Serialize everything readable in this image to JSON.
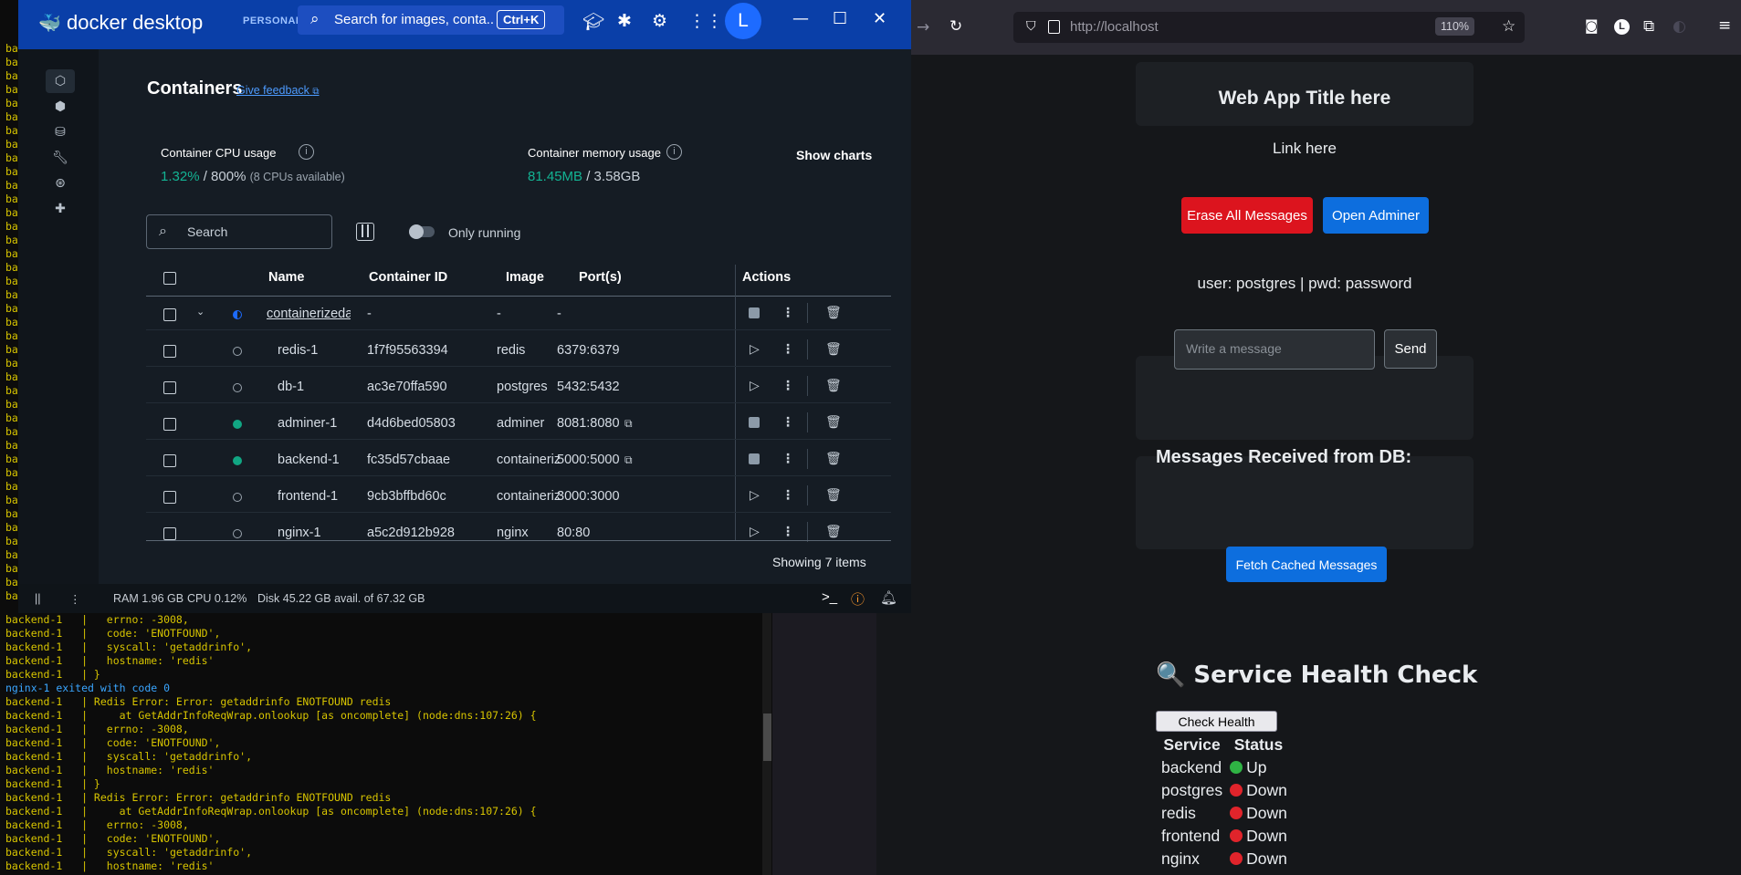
{
  "terminal": {
    "lines": [
      {
        "t": "backend-1   |   errno: -3008,",
        "c": "y"
      },
      {
        "t": "backend-1   |   code: 'ENOTFOUND',",
        "c": "y"
      },
      {
        "t": "backend-1   |   syscall: 'getaddrinfo',",
        "c": "y"
      },
      {
        "t": "backend-1   |   hostname: 'redis'",
        "c": "y"
      },
      {
        "t": "backend-1   | }",
        "c": "y"
      },
      {
        "t": "nginx-1 exited with code 0",
        "c": "c"
      },
      {
        "t": "backend-1   | Redis Error: Error: getaddrinfo ENOTFOUND redis",
        "c": "y"
      },
      {
        "t": "backend-1   |     at GetAddrInfoReqWrap.onlookup [as oncomplete] (node:dns:107:26) {",
        "c": "y"
      },
      {
        "t": "backend-1   |   errno: -3008,",
        "c": "y"
      },
      {
        "t": "backend-1   |   code: 'ENOTFOUND',",
        "c": "y"
      },
      {
        "t": "backend-1   |   syscall: 'getaddrinfo',",
        "c": "y"
      },
      {
        "t": "backend-1   |   hostname: 'redis'",
        "c": "y"
      },
      {
        "t": "backend-1   | }",
        "c": "y"
      },
      {
        "t": "backend-1   | Redis Error: Error: getaddrinfo ENOTFOUND redis",
        "c": "y"
      },
      {
        "t": "backend-1   |     at GetAddrInfoReqWrap.onlookup [as oncomplete] (node:dns:107:26) {",
        "c": "y"
      },
      {
        "t": "backend-1   |   errno: -3008,",
        "c": "y"
      },
      {
        "t": "backend-1   |   code: 'ENOTFOUND',",
        "c": "y"
      },
      {
        "t": "backend-1   |   syscall: 'getaddrinfo',",
        "c": "y"
      },
      {
        "t": "backend-1   |   hostname: 'redis'",
        "c": "y"
      }
    ],
    "prefix": "ba"
  },
  "docker": {
    "brand": "docker desktop",
    "plan": "PERSONAL",
    "search_placeholder": "Search for images, conta...",
    "search_shortcut": "Ctrl+K",
    "avatar_letter": "L",
    "page_title": "Containers",
    "feedback_link": "Give feedback",
    "cpu_label": "Container CPU usage",
    "cpu_value": "1.32%",
    "cpu_total": "/ 800%",
    "cpu_note": "(8 CPUs available)",
    "mem_label": "Container memory usage",
    "mem_value": "81.45MB",
    "mem_total": "/ 3.58GB",
    "show_charts": "Show charts",
    "filter_placeholder": "Search",
    "only_running": "Only running",
    "columns": {
      "name": "Name",
      "id": "Container ID",
      "image": "Image",
      "ports": "Port(s)",
      "actions": "Actions"
    },
    "rows": [
      {
        "name": "containerizedap",
        "id": "-",
        "image": "-",
        "ports": "-",
        "status": "partial",
        "group": true
      },
      {
        "name": "redis-1",
        "id": "1f7f95563394",
        "image": "redis",
        "ports": "6379:6379",
        "status": "stopped"
      },
      {
        "name": "db-1",
        "id": "ac3e70ffa590",
        "image": "postgres",
        "ports": "5432:5432",
        "status": "stopped"
      },
      {
        "name": "adminer-1",
        "id": "d4d6bed05803",
        "image": "adminer",
        "ports": "8081:8080",
        "status": "running",
        "link": true
      },
      {
        "name": "backend-1",
        "id": "fc35d57cbaae",
        "image": "containeriz",
        "ports": "5000:5000",
        "status": "running",
        "link": true
      },
      {
        "name": "frontend-1",
        "id": "9cb3bffbd60c",
        "image": "containeriz",
        "ports": "3000:3000",
        "status": "stopped"
      },
      {
        "name": "nginx-1",
        "id": "a5c2d912b928",
        "image": "nginx",
        "ports": "80:80",
        "status": "stopped"
      }
    ],
    "showing": "Showing 7 items",
    "footer": {
      "ram": "RAM 1.96 GB",
      "cpu": "CPU 0.12%",
      "disk": "Disk 45.22 GB avail. of 67.32 GB"
    },
    "colors": {
      "accent": "#1d6bff",
      "running": "#11a683",
      "title_bar": "#0a3fa8"
    }
  },
  "browser": {
    "url": "http://localhost",
    "zoom": "110%",
    "profile_letter": "L"
  },
  "webapp": {
    "title": "Web App Title here",
    "link": "Link here",
    "erase_button": "Erase All Messages",
    "adminer_button": "Open Adminer",
    "credentials": "user: postgres | pwd: password",
    "message_placeholder": "Write a message",
    "send_button": "Send",
    "messages_heading": "Messages Received from DB:",
    "fetch_button": "Fetch Cached Messages",
    "health_heading": "🔍 Service Health Check",
    "health_button": "Check Health",
    "health_columns": {
      "service": "Service",
      "status": "Status"
    },
    "health_rows": [
      {
        "service": "backend",
        "status": "Up",
        "color": "#2fb344"
      },
      {
        "service": "postgres",
        "status": "Down",
        "color": "#e0242b"
      },
      {
        "service": "redis",
        "status": "Down",
        "color": "#e0242b"
      },
      {
        "service": "frontend",
        "status": "Down",
        "color": "#e0242b"
      },
      {
        "service": "nginx",
        "status": "Down",
        "color": "#e0242b"
      }
    ]
  }
}
